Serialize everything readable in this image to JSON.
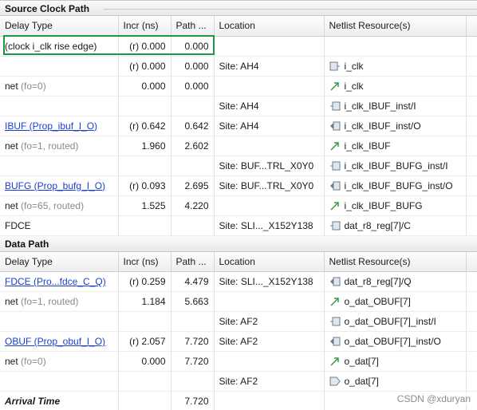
{
  "source_clock": {
    "title": "Source Clock Path",
    "headers": [
      "Delay Type",
      "Incr (ns)",
      "Path ...",
      "Location",
      "Netlist Resource(s)"
    ],
    "rows": [
      {
        "type": "(clock i_clk rise edge)",
        "type_link": false,
        "fo": "",
        "incr": "(r) 0.000",
        "path": "0.000",
        "location": "",
        "resource": "",
        "icon": ""
      },
      {
        "type": "",
        "type_link": false,
        "fo": "",
        "incr": "(r) 0.000",
        "path": "0.000",
        "location": "Site: AH4",
        "resource": "i_clk",
        "icon": "port-icon"
      },
      {
        "type": "net",
        "type_link": false,
        "fo": "(fo=0)",
        "incr": "0.000",
        "path": "0.000",
        "location": "",
        "resource": "i_clk",
        "icon": "net-icon"
      },
      {
        "type": "",
        "type_link": false,
        "fo": "",
        "incr": "",
        "path": "",
        "location": "Site: AH4",
        "resource": "i_clk_IBUF_inst/I",
        "icon": "pin-in-icon"
      },
      {
        "type": "IBUF (Prop_ibuf_I_O)",
        "type_link": true,
        "fo": "",
        "incr": "(r) 0.642",
        "path": "0.642",
        "location": "Site: AH4",
        "resource": "i_clk_IBUF_inst/O",
        "icon": "pin-out-icon"
      },
      {
        "type": "net",
        "type_link": false,
        "fo": "(fo=1, routed)",
        "incr": "1.960",
        "path": "2.602",
        "location": "",
        "resource": "i_clk_IBUF",
        "icon": "net-icon"
      },
      {
        "type": "",
        "type_link": false,
        "fo": "",
        "incr": "",
        "path": "",
        "location": "Site: BUF...TRL_X0Y0",
        "resource": "i_clk_IBUF_BUFG_inst/I",
        "icon": "pin-in-icon"
      },
      {
        "type": "BUFG (Prop_bufg_I_O)",
        "type_link": true,
        "fo": "",
        "incr": "(r) 0.093",
        "path": "2.695",
        "location": "Site: BUF...TRL_X0Y0",
        "resource": "i_clk_IBUF_BUFG_inst/O",
        "icon": "pin-out-icon"
      },
      {
        "type": "net",
        "type_link": false,
        "fo": "(fo=65, routed)",
        "incr": "1.525",
        "path": "4.220",
        "location": "",
        "resource": "i_clk_IBUF_BUFG",
        "icon": "net-icon"
      },
      {
        "type": "FDCE",
        "type_link": false,
        "fo": "",
        "incr": "",
        "path": "",
        "location": "Site: SLI..._X152Y138",
        "resource": "dat_r8_reg[7]/C",
        "icon": "pin-in-icon"
      }
    ]
  },
  "data_path": {
    "title": "Data Path",
    "headers": [
      "Delay Type",
      "Incr (ns)",
      "Path ...",
      "Location",
      "Netlist Resource(s)"
    ],
    "rows": [
      {
        "type": "FDCE (Pro...fdce_C_Q)",
        "type_link": true,
        "fo": "",
        "incr": "(r) 0.259",
        "path": "4.479",
        "location": "Site: SLI..._X152Y138",
        "resource": "dat_r8_reg[7]/Q",
        "icon": "pin-out-icon"
      },
      {
        "type": "net",
        "type_link": false,
        "fo": "(fo=1, routed)",
        "incr": "1.184",
        "path": "5.663",
        "location": "",
        "resource": "o_dat_OBUF[7]",
        "icon": "net-icon"
      },
      {
        "type": "",
        "type_link": false,
        "fo": "",
        "incr": "",
        "path": "",
        "location": "Site: AF2",
        "resource": "o_dat_OBUF[7]_inst/I",
        "icon": "pin-in-icon"
      },
      {
        "type": "OBUF (Prop_obuf_I_O)",
        "type_link": true,
        "fo": "",
        "incr": "(r) 2.057",
        "path": "7.720",
        "location": "Site: AF2",
        "resource": "o_dat_OBUF[7]_inst/O",
        "icon": "pin-out-icon"
      },
      {
        "type": "net",
        "type_link": false,
        "fo": "(fo=0)",
        "incr": "0.000",
        "path": "7.720",
        "location": "",
        "resource": "o_dat[7]",
        "icon": "net-icon"
      },
      {
        "type": "",
        "type_link": false,
        "fo": "",
        "incr": "",
        "path": "",
        "location": "Site: AF2",
        "resource": "o_dat[7]",
        "icon": "port-out-icon"
      },
      {
        "type": "Arrival Time",
        "type_link": false,
        "fo": "",
        "incr": "",
        "path": "7.720",
        "location": "",
        "resource": "",
        "icon": "",
        "bold": true
      }
    ]
  },
  "colors": {
    "link": "#1a3fd0",
    "highlight": "#1a9a3a",
    "net_arrow": "#2a9a3a",
    "pin_icon": "#7a8794"
  },
  "watermark": "CSDN @xduryan"
}
